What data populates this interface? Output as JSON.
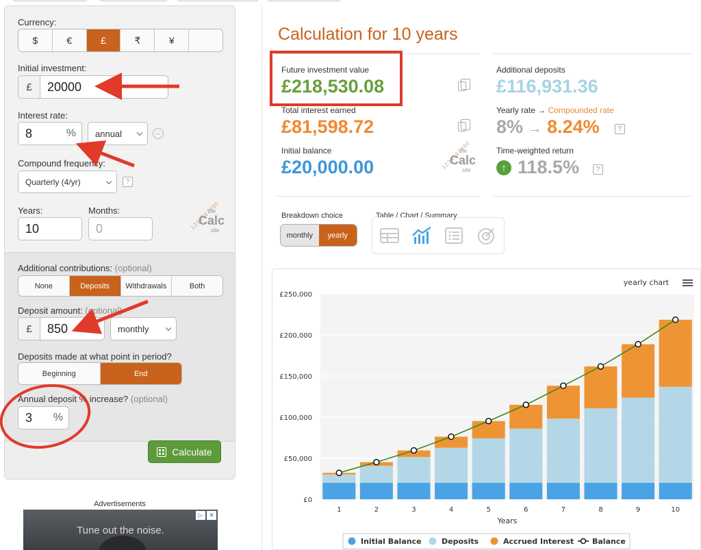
{
  "form": {
    "currency": {
      "label": "Currency:",
      "options": [
        "$",
        "€",
        "£",
        "₹",
        "¥",
        ""
      ],
      "selected": "£"
    },
    "initial_investment": {
      "label": "Initial investment:",
      "prefix": "£",
      "value": "20000"
    },
    "interest_rate": {
      "label": "Interest rate:",
      "value": "8",
      "suffix": "%",
      "period": "annual"
    },
    "compound_frequency": {
      "label": "Compound frequency:",
      "value": "Quarterly (4/yr)",
      "help": "?"
    },
    "years": {
      "label": "Years:",
      "value": "10"
    },
    "months": {
      "label": "Months:",
      "placeholder": "0"
    },
    "additional_contributions": {
      "label": "Additional contributions:",
      "optional": "(optional)",
      "options": [
        "None",
        "Deposits",
        "Withdrawals",
        "Both"
      ],
      "selected": "Deposits"
    },
    "deposit_amount": {
      "label": "Deposit amount:",
      "optional": "(optional)",
      "prefix": "£",
      "value": "850",
      "period": "monthly"
    },
    "deposit_timing": {
      "label": "Deposits made at what point in period?",
      "options": [
        "Beginning",
        "End"
      ],
      "selected": "End"
    },
    "annual_increase": {
      "label": "Annual deposit % increase?",
      "optional": "(optional)",
      "value": "3",
      "suffix": "%"
    },
    "calculate_label": "Calculate"
  },
  "logo": {
    "digits": "1234567890",
    "the": "the",
    "calc": "Calc",
    "site": "site"
  },
  "ads": {
    "label": "Advertisements",
    "text": "Tune out the noise.",
    "info": "▷",
    "close": "✕"
  },
  "results": {
    "title": "Calculation for 10 years",
    "future_value": {
      "label": "Future investment value",
      "value": "£218,530.08",
      "color": "#6a9f3a"
    },
    "total_interest": {
      "label": "Total interest earned",
      "value": "£81,598.72",
      "color": "#ef8a2f"
    },
    "initial_balance": {
      "label": "Initial balance",
      "value": "£20,000.00",
      "color": "#3b97d9"
    },
    "additional_deposits": {
      "label": "Additional deposits",
      "value": "£116,931.36",
      "color": "#a8d2e6"
    },
    "yearly_rate": {
      "label": "Yearly rate →",
      "label_hl": "Compounded rate",
      "rate": "8%",
      "arrow": "→",
      "compounded": "8.24%",
      "help": "?"
    },
    "time_weighted": {
      "label": "Time-weighted return",
      "value": "118.5%",
      "help": "?"
    }
  },
  "breakdown": {
    "label": "Breakdown choice",
    "options": [
      "monthly",
      "yearly"
    ],
    "selected": "yearly"
  },
  "views": {
    "label": "Table / Chart / Summary"
  },
  "chart_data": {
    "type": "bar",
    "title": "yearly chart",
    "xlabel": "Years",
    "ylabel": "",
    "categories": [
      "1",
      "2",
      "3",
      "4",
      "5",
      "6",
      "7",
      "8",
      "9",
      "10"
    ],
    "ylim": [
      0,
      250000
    ],
    "yticks": [
      "£0",
      "£50,000",
      "£100,000",
      "£150,000",
      "£200,000",
      "£250,000"
    ],
    "stacked": true,
    "series": [
      {
        "name": "Initial Balance",
        "color": "#4aa3e5",
        "values": [
          20000,
          20000,
          20000,
          20000,
          20000,
          20000,
          20000,
          20000,
          20000,
          20000
        ]
      },
      {
        "name": "Deposits",
        "color": "#b3d7e6",
        "values": [
          10200,
          20700,
          31500,
          42700,
          54200,
          66000,
          78200,
          90700,
          103700,
          116900
        ]
      },
      {
        "name": "Accrued Interest",
        "color": "#ef9434",
        "values": [
          2000,
          4500,
          8000,
          13500,
          21000,
          29000,
          40000,
          51000,
          65000,
          81600
        ]
      }
    ],
    "line": {
      "name": "Balance",
      "color": "#3e8a1f",
      "values": [
        32200,
        45200,
        59500,
        76200,
        95200,
        115000,
        138200,
        161700,
        188700,
        218500
      ]
    },
    "legend": "bottom"
  }
}
